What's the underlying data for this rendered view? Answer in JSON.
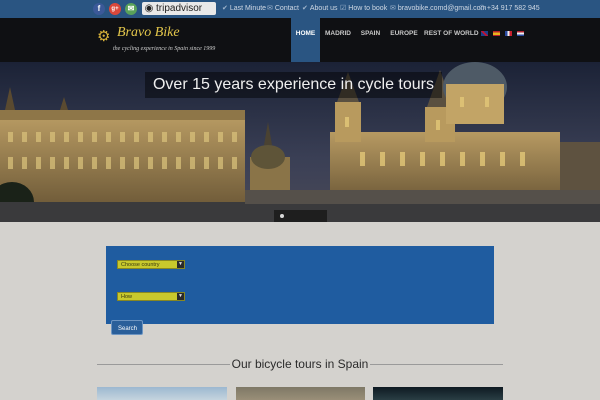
{
  "topbar": {
    "social": [
      {
        "name": "facebook-icon",
        "glyph": "f",
        "color": "#3b5998"
      },
      {
        "name": "google-plus-icon",
        "glyph": "g+",
        "color": "#d9483b"
      },
      {
        "name": "mail-icon",
        "glyph": "✉",
        "color": "#5aa25a"
      }
    ],
    "tripadvisor": "tripadvisor",
    "links": [
      {
        "icon": "✔",
        "label": "Last Minute"
      },
      {
        "icon": "✉",
        "label": "Contact"
      },
      {
        "icon": "✔",
        "label": "About us"
      },
      {
        "icon": "☑",
        "label": "How to book"
      },
      {
        "icon": "✉",
        "label": "bravobike.comd@gmail.com"
      },
      {
        "icon": "✆",
        "label": "+34 917 582 945"
      }
    ]
  },
  "logo": {
    "name": "Bravo Bike",
    "tagline": "the cycling experience in Spain since 1999"
  },
  "nav": {
    "items": [
      "HOME",
      "MADRID",
      "SPAIN",
      "EUROPE",
      "REST OF WORLD"
    ],
    "active": "HOME"
  },
  "hero": {
    "title": "Over 15 years experience in cycle tours"
  },
  "search": {
    "country_select": "Choose country",
    "how_select": "How",
    "button": "Search"
  },
  "tours": {
    "heading": "Our bicycle tours in Spain"
  },
  "colors": {
    "topbar": "#2a5582",
    "navbar": "#0f1013",
    "panel": "#1f5ca0",
    "select": "#c8c82c"
  }
}
